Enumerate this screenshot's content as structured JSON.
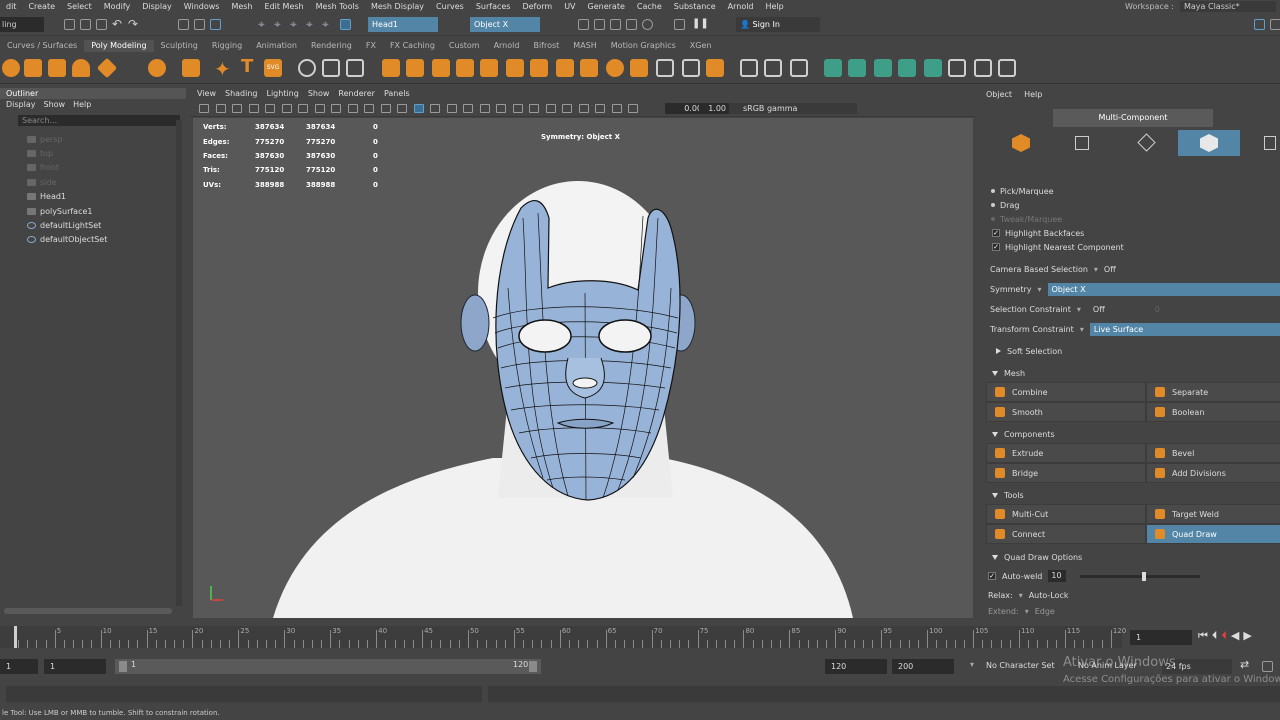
{
  "menubar": {
    "items": [
      "dit",
      "Create",
      "Select",
      "Modify",
      "Display",
      "Windows",
      "Mesh",
      "Edit Mesh",
      "Mesh Tools",
      "Mesh Display",
      "Curves",
      "Surfaces",
      "Deform",
      "UV",
      "Generate",
      "Cache",
      "Substance",
      "Arnold",
      "Help"
    ],
    "workspace_label": "Workspace :",
    "workspace_value": "Maya Classic*"
  },
  "statusline": {
    "mode": "ling",
    "object_name": "Head1",
    "symmetry": "Object X",
    "sign_in": "Sign In"
  },
  "shelf_tabs": [
    "Curves / Surfaces",
    "Poly Modeling",
    "Sculpting",
    "Rigging",
    "Animation",
    "Rendering",
    "FX",
    "FX Caching",
    "Custom",
    "Arnold",
    "Bifrost",
    "MASH",
    "Motion Graphics",
    "XGen"
  ],
  "shelf_active_tab": "Poly Modeling",
  "shelf_text_icons": {
    "text": "T",
    "svg": "SVG"
  },
  "outliner": {
    "title": "Outliner",
    "menu": [
      "Display",
      "Show",
      "Help"
    ],
    "search_placeholder": "Search...",
    "items": [
      {
        "label": "persp",
        "kind": "cam"
      },
      {
        "label": "top",
        "kind": "cam"
      },
      {
        "label": "front",
        "kind": "cam"
      },
      {
        "label": "side",
        "kind": "cam"
      },
      {
        "label": "Head1",
        "kind": "mesh"
      },
      {
        "label": "polySurface1",
        "kind": "mesh"
      },
      {
        "label": "defaultLightSet",
        "kind": "set"
      },
      {
        "label": "defaultObjectSet",
        "kind": "set"
      }
    ]
  },
  "viewport": {
    "menu": [
      "View",
      "Shading",
      "Lighting",
      "Show",
      "Renderer",
      "Panels"
    ],
    "exposure": "0.00",
    "gamma": "1.00",
    "color_space": "sRGB gamma",
    "symmetry_label": "Symmetry: Object X",
    "hud": [
      {
        "label": "Verts:",
        "a": "387634",
        "b": "387634",
        "c": "0"
      },
      {
        "label": "Edges:",
        "a": "775270",
        "b": "775270",
        "c": "0"
      },
      {
        "label": "Faces:",
        "a": "387630",
        "b": "387630",
        "c": "0"
      },
      {
        "label": "Tris:",
        "a": "775120",
        "b": "775120",
        "c": "0"
      },
      {
        "label": "UVs:",
        "a": "388988",
        "b": "388988",
        "c": "0"
      }
    ]
  },
  "toolkit": {
    "menu": [
      "Object",
      "Help"
    ],
    "title": "Multi-Component",
    "selection_modes": [
      "Pick/Marquee",
      "Drag",
      "Tweak/Marquee"
    ],
    "checks": [
      "Highlight Backfaces",
      "Highlight Nearest Component"
    ],
    "camera_based_label": "Camera Based Selection",
    "camera_based_value": "Off",
    "symmetry_label": "Symmetry",
    "symmetry_value": "Object X",
    "sel_constraint_label": "Selection Constraint",
    "sel_constraint_value": "Off",
    "sel_constraint_num": "0",
    "transform_constraint_label": "Transform Constraint",
    "transform_constraint_value": "Live Surface",
    "soft_selection": "Soft Selection",
    "mesh_section": "Mesh",
    "mesh_buttons": [
      "Combine",
      "Separate",
      "Smooth",
      "Boolean"
    ],
    "components_section": "Components",
    "component_buttons": [
      "Extrude",
      "Bevel",
      "Bridge",
      "Add Divisions"
    ],
    "tools_section": "Tools",
    "tool_buttons": [
      "Multi-Cut",
      "Target Weld",
      "Connect",
      "Quad Draw"
    ],
    "quad_draw_options": "Quad Draw Options",
    "auto_weld_label": "Auto-weld",
    "auto_weld_value": "10",
    "relax_label": "Relax:",
    "relax_value": "Auto-Lock",
    "extend_label": "Extend:",
    "extend_value": "Edge"
  },
  "timeline": {
    "ticks": [
      "5",
      "10",
      "15",
      "20",
      "25",
      "30",
      "35",
      "40",
      "45",
      "50",
      "55",
      "60",
      "65",
      "70",
      "75",
      "80",
      "85",
      "90",
      "95",
      "100",
      "105",
      "110",
      "115",
      "120"
    ],
    "current_frame": "1"
  },
  "range": {
    "start": "1",
    "range_start": "1",
    "slider_start": "1",
    "slider_end": "120",
    "range_end": "120",
    "end": "200",
    "character_set": "No Character Set",
    "anim_layer": "No Anim Layer",
    "fps": "24 fps"
  },
  "watermark": {
    "line1": "Ativar o Windows",
    "line2": "Acesse Configurações para ativar o Windows."
  },
  "help_line": "le Tool: Use LMB or MMB to tumble. Shift to constrain rotation."
}
